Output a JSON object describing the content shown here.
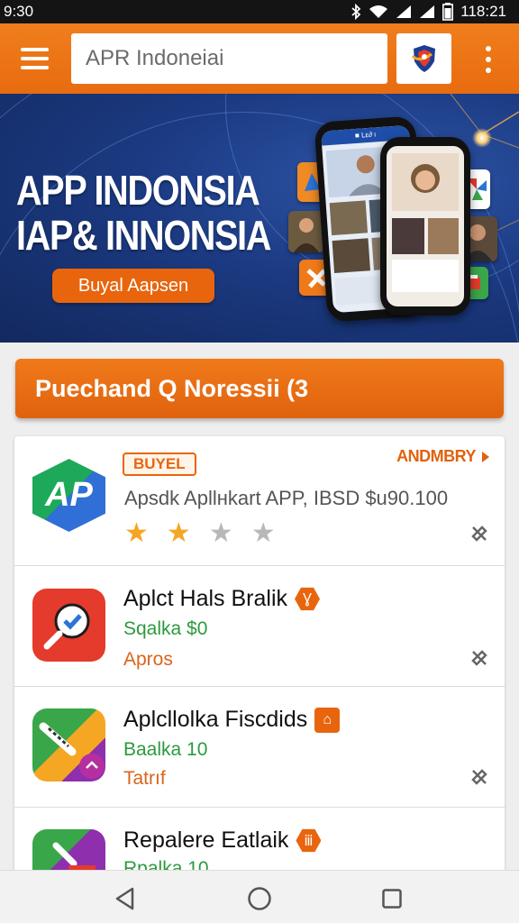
{
  "status_bar": {
    "time_left": "9:30",
    "time_right": "118:21"
  },
  "toolbar": {
    "search_value": "APR Indoneiai"
  },
  "banner": {
    "title_line1": "APP INDONSIA",
    "title_line2": "IAP& INNONSIA",
    "button_label": "Buyal Aapsen",
    "phone_header": "■ Lε∂ ι"
  },
  "section": {
    "title": "Puechand Q Noressii (3"
  },
  "featured": {
    "icon_text": "AP",
    "badge": "BUYEL",
    "more_label": "ANDMBRY",
    "description": "Apsdk Apllнkart APP, IBSD $u90.100",
    "rating": 2,
    "max_rating": 5
  },
  "apps": [
    {
      "title": "Aplct Hals Bralik",
      "subtitle": "Sqalka $0",
      "category": "Apros",
      "hex_glyph": "Ɣ"
    },
    {
      "title": "Aplcllolka Fiscdids",
      "subtitle": "Baalka 10",
      "category": "Tatrıf",
      "hex_glyph": "⌂"
    },
    {
      "title": "Repalere Eatlaik",
      "subtitle": "Rpalka 10",
      "category": "",
      "hex_glyph": "ⅲ"
    }
  ],
  "colors": {
    "accent": "#e8650e",
    "banner_blue": "#1b3a82",
    "star": "#f5a623",
    "price_green": "#2b9a3e"
  }
}
